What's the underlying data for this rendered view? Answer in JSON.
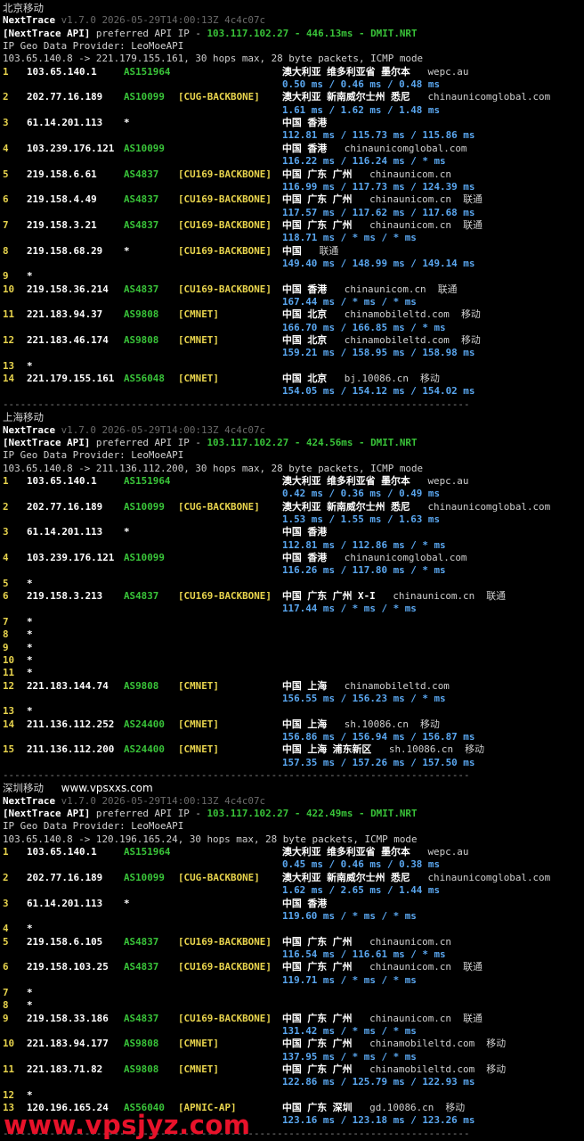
{
  "watermark": "www.vpsjyz.com",
  "sections": [
    {
      "title": "北京移动",
      "site": "",
      "app_name": "NextTrace",
      "version": "v1.7.0 2026-05-29T14:00:13Z 4c4c07c",
      "api_tag": "[NextTrace API]",
      "api_text": "preferred API IP - ",
      "api_ip": "103.117.102.27 - 446.13ms - DMIT.NRT",
      "geo_provider": "IP Geo Data Provider: LeoMoeAPI",
      "route": "103.65.140.8 -> 221.179.155.161, 30 hops max, 28 byte packets, ICMP mode",
      "hops": [
        {
          "n": "1",
          "ip": "103.65.140.1",
          "as": "AS151964",
          "tag": "",
          "geo": "澳大利亚 维多利亚省 墨尔本",
          "host": "wepc.au",
          "isp": "",
          "lat": "0.50 ms / 0.46 ms / 0.48 ms"
        },
        {
          "n": "2",
          "ip": "202.77.16.189",
          "as": "AS10099",
          "tag": "[CUG-BACKBONE]",
          "geo": "澳大利亚 新南威尔士州 悉尼",
          "host": "chinaunicomglobal.com",
          "isp": "",
          "lat": "1.61 ms / 1.62 ms / 1.48 ms"
        },
        {
          "n": "3",
          "ip": "61.14.201.113",
          "as": "*",
          "tag": "",
          "geo": "中国 香港",
          "host": "",
          "isp": "",
          "lat": "112.81 ms / 115.73 ms / 115.86 ms"
        },
        {
          "n": "4",
          "ip": "103.239.176.121",
          "as": "AS10099",
          "tag": "",
          "geo": "中国 香港",
          "host": "chinaunicomglobal.com",
          "isp": "",
          "lat": "116.22 ms / 116.24 ms / * ms"
        },
        {
          "n": "5",
          "ip": "219.158.6.61",
          "as": "AS4837",
          "tag": "[CU169-BACKBONE]",
          "geo": "中国 广东 广州",
          "host": "chinaunicom.cn",
          "isp": "",
          "lat": "116.99 ms / 117.73 ms / 124.39 ms"
        },
        {
          "n": "6",
          "ip": "219.158.4.49",
          "as": "AS4837",
          "tag": "[CU169-BACKBONE]",
          "geo": "中国 广东 广州",
          "host": "chinaunicom.cn",
          "isp": "联通",
          "lat": "117.57 ms / 117.62 ms / 117.68 ms"
        },
        {
          "n": "7",
          "ip": "219.158.3.21",
          "as": "AS4837",
          "tag": "[CU169-BACKBONE]",
          "geo": "中国 广东 广州",
          "host": "chinaunicom.cn",
          "isp": "联通",
          "lat": "118.71 ms / * ms / * ms"
        },
        {
          "n": "8",
          "ip": "219.158.68.29",
          "as": "*",
          "tag": "[CU169-BACKBONE]",
          "geo": "中国",
          "host": "",
          "isp": "联通",
          "lat": "149.40 ms / 148.99 ms / 149.14 ms"
        },
        {
          "n": "9",
          "ip": "*",
          "as": "",
          "tag": "",
          "geo": "",
          "host": "",
          "isp": "",
          "lat": ""
        },
        {
          "n": "10",
          "ip": "219.158.36.214",
          "as": "AS4837",
          "tag": "[CU169-BACKBONE]",
          "geo": "中国 香港",
          "host": "chinaunicom.cn",
          "isp": "联通",
          "lat": "167.44 ms / * ms / * ms"
        },
        {
          "n": "11",
          "ip": "221.183.94.37",
          "as": "AS9808",
          "tag": "[CMNET]",
          "geo": "中国 北京",
          "host": "chinamobileltd.com",
          "isp": "移动",
          "lat": "166.70 ms / 166.85 ms / * ms"
        },
        {
          "n": "12",
          "ip": "221.183.46.174",
          "as": "AS9808",
          "tag": "[CMNET]",
          "geo": "中国 北京",
          "host": "chinamobileltd.com",
          "isp": "移动",
          "lat": "159.21 ms / 158.95 ms / 158.98 ms"
        },
        {
          "n": "13",
          "ip": "*",
          "as": "",
          "tag": "",
          "geo": "",
          "host": "",
          "isp": "",
          "lat": ""
        },
        {
          "n": "14",
          "ip": "221.179.155.161",
          "as": "AS56048",
          "tag": "[CMNET]",
          "geo": "中国 北京",
          "host": "bj.10086.cn",
          "isp": "移动",
          "lat": "154.05 ms / 154.12 ms / 154.02 ms"
        }
      ]
    },
    {
      "title": "上海移动",
      "site": "",
      "app_name": "NextTrace",
      "version": "v1.7.0 2026-05-29T14:00:13Z 4c4c07c",
      "api_tag": "[NextTrace API]",
      "api_text": "preferred API IP - ",
      "api_ip": "103.117.102.27 - 424.56ms - DMIT.NRT",
      "geo_provider": "IP Geo Data Provider: LeoMoeAPI",
      "route": "103.65.140.8 -> 211.136.112.200, 30 hops max, 28 byte packets, ICMP mode",
      "hops": [
        {
          "n": "1",
          "ip": "103.65.140.1",
          "as": "AS151964",
          "tag": "",
          "geo": "澳大利亚 维多利亚省 墨尔本",
          "host": "wepc.au",
          "isp": "",
          "lat": "0.42 ms / 0.36 ms / 0.49 ms"
        },
        {
          "n": "2",
          "ip": "202.77.16.189",
          "as": "AS10099",
          "tag": "[CUG-BACKBONE]",
          "geo": "澳大利亚 新南威尔士州 悉尼",
          "host": "chinaunicomglobal.com",
          "isp": "",
          "lat": "1.53 ms / 1.55 ms / 1.63 ms"
        },
        {
          "n": "3",
          "ip": "61.14.201.113",
          "as": "*",
          "tag": "",
          "geo": "中国 香港",
          "host": "",
          "isp": "",
          "lat": "112.81 ms / 112.86 ms / * ms"
        },
        {
          "n": "4",
          "ip": "103.239.176.121",
          "as": "AS10099",
          "tag": "",
          "geo": "中国 香港",
          "host": "chinaunicomglobal.com",
          "isp": "",
          "lat": "116.26 ms / 117.80 ms / * ms"
        },
        {
          "n": "5",
          "ip": "*",
          "as": "",
          "tag": "",
          "geo": "",
          "host": "",
          "isp": "",
          "lat": ""
        },
        {
          "n": "6",
          "ip": "219.158.3.213",
          "as": "AS4837",
          "tag": "[CU169-BACKBONE]",
          "geo": "中国 广东 广州 X-I",
          "host": "chinaunicom.cn",
          "isp": "联通",
          "lat": "117.44 ms / * ms / * ms"
        },
        {
          "n": "7",
          "ip": "*",
          "as": "",
          "tag": "",
          "geo": "",
          "host": "",
          "isp": "",
          "lat": ""
        },
        {
          "n": "8",
          "ip": "*",
          "as": "",
          "tag": "",
          "geo": "",
          "host": "",
          "isp": "",
          "lat": ""
        },
        {
          "n": "9",
          "ip": "*",
          "as": "",
          "tag": "",
          "geo": "",
          "host": "",
          "isp": "",
          "lat": ""
        },
        {
          "n": "10",
          "ip": "*",
          "as": "",
          "tag": "",
          "geo": "",
          "host": "",
          "isp": "",
          "lat": ""
        },
        {
          "n": "11",
          "ip": "*",
          "as": "",
          "tag": "",
          "geo": "",
          "host": "",
          "isp": "",
          "lat": ""
        },
        {
          "n": "12",
          "ip": "221.183.144.74",
          "as": "AS9808",
          "tag": "[CMNET]",
          "geo": "中国 上海",
          "host": "chinamobileltd.com",
          "isp": "",
          "lat": "156.55 ms / 156.23 ms / * ms"
        },
        {
          "n": "13",
          "ip": "*",
          "as": "",
          "tag": "",
          "geo": "",
          "host": "",
          "isp": "",
          "lat": ""
        },
        {
          "n": "14",
          "ip": "211.136.112.252",
          "as": "AS24400",
          "tag": "[CMNET]",
          "geo": "中国 上海",
          "host": "sh.10086.cn",
          "isp": "移动",
          "lat": "156.86 ms / 156.94 ms / 156.87 ms"
        },
        {
          "n": "15",
          "ip": "211.136.112.200",
          "as": "AS24400",
          "tag": "[CMNET]",
          "geo": "中国 上海 浦东新区",
          "host": "sh.10086.cn",
          "isp": "移动",
          "lat": "157.35 ms / 157.26 ms / 157.50 ms"
        }
      ]
    },
    {
      "title": "深圳移动",
      "site": "www.vpsxxs.com",
      "app_name": "NextTrace",
      "version": "v1.7.0 2026-05-29T14:00:13Z 4c4c07c",
      "api_tag": "[NextTrace API]",
      "api_text": "preferred API IP - ",
      "api_ip": "103.117.102.27 - 422.49ms - DMIT.NRT",
      "geo_provider": "IP Geo Data Provider: LeoMoeAPI",
      "route": "103.65.140.8 -> 120.196.165.24, 30 hops max, 28 byte packets, ICMP mode",
      "hops": [
        {
          "n": "1",
          "ip": "103.65.140.1",
          "as": "AS151964",
          "tag": "",
          "geo": "澳大利亚 维多利亚省 墨尔本",
          "host": "wepc.au",
          "isp": "",
          "lat": "0.45 ms / 0.46 ms / 0.38 ms"
        },
        {
          "n": "2",
          "ip": "202.77.16.189",
          "as": "AS10099",
          "tag": "[CUG-BACKBONE]",
          "geo": "澳大利亚 新南威尔士州 悉尼",
          "host": "chinaunicomglobal.com",
          "isp": "",
          "lat": "1.62 ms / 2.65 ms / 1.44 ms"
        },
        {
          "n": "3",
          "ip": "61.14.201.113",
          "as": "*",
          "tag": "",
          "geo": "中国 香港",
          "host": "",
          "isp": "",
          "lat": "119.60 ms / * ms / * ms"
        },
        {
          "n": "4",
          "ip": "*",
          "as": "",
          "tag": "",
          "geo": "",
          "host": "",
          "isp": "",
          "lat": ""
        },
        {
          "n": "5",
          "ip": "219.158.6.105",
          "as": "AS4837",
          "tag": "[CU169-BACKBONE]",
          "geo": "中国 广东 广州",
          "host": "chinaunicom.cn",
          "isp": "",
          "lat": "116.54 ms / 116.61 ms / * ms"
        },
        {
          "n": "6",
          "ip": "219.158.103.25",
          "as": "AS4837",
          "tag": "[CU169-BACKBONE]",
          "geo": "中国 广东 广州",
          "host": "chinaunicom.cn",
          "isp": "联通",
          "lat": "119.71 ms / * ms / * ms"
        },
        {
          "n": "7",
          "ip": "*",
          "as": "",
          "tag": "",
          "geo": "",
          "host": "",
          "isp": "",
          "lat": ""
        },
        {
          "n": "8",
          "ip": "*",
          "as": "",
          "tag": "",
          "geo": "",
          "host": "",
          "isp": "",
          "lat": ""
        },
        {
          "n": "9",
          "ip": "219.158.33.186",
          "as": "AS4837",
          "tag": "[CU169-BACKBONE]",
          "geo": "中国 广东 广州",
          "host": "chinaunicom.cn",
          "isp": "联通",
          "lat": "131.42 ms / * ms / * ms"
        },
        {
          "n": "10",
          "ip": "221.183.94.177",
          "as": "AS9808",
          "tag": "[CMNET]",
          "geo": "中国 广东 广州",
          "host": "chinamobileltd.com",
          "isp": "移动",
          "lat": "137.95 ms / * ms / * ms"
        },
        {
          "n": "11",
          "ip": "221.183.71.82",
          "as": "AS9808",
          "tag": "[CMNET]",
          "geo": "中国 广东 广州",
          "host": "chinamobileltd.com",
          "isp": "移动",
          "lat": "122.86 ms / 125.79 ms / 122.93 ms"
        },
        {
          "n": "12",
          "ip": "*",
          "as": "",
          "tag": "",
          "geo": "",
          "host": "",
          "isp": "",
          "lat": ""
        },
        {
          "n": "13",
          "ip": "120.196.165.24",
          "as": "AS56040",
          "tag": "[APNIC-AP]",
          "geo": "中国 广东 深圳",
          "host": "gd.10086.cn",
          "isp": "移动",
          "lat": "123.16 ms / 123.18 ms / 123.26 ms"
        }
      ]
    }
  ]
}
